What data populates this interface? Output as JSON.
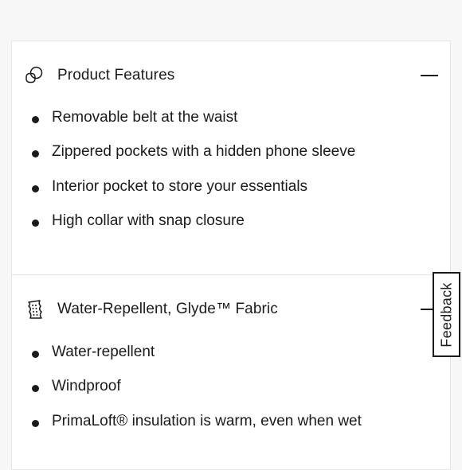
{
  "sections": [
    {
      "icon": "fabric-overlap-icon",
      "title": "Product Features",
      "toggle": "collapse",
      "items": [
        "Removable belt at the waist",
        "Zippered pockets with a hidden phone sleeve",
        "Interior pocket to store your essentials",
        "High collar with snap closure"
      ]
    },
    {
      "icon": "fabric-swatch-icon",
      "title": "Water-Repellent, Glyde™ Fabric",
      "toggle": "collapse",
      "items": [
        "Water-repellent",
        "Windproof",
        "PrimaLoft® insulation is warm, even when wet"
      ]
    }
  ],
  "feedback": {
    "label": "Feedback"
  },
  "colors": {
    "text": "#1b1b1b",
    "background": "#f7f7f7",
    "card": "#ffffff",
    "divider": "#e3e3e3"
  }
}
